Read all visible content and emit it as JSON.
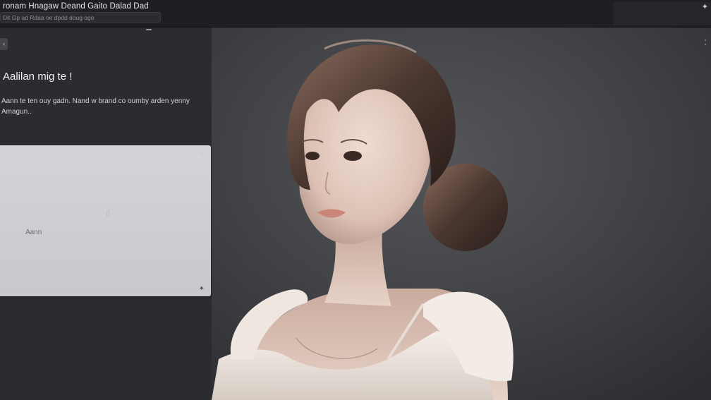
{
  "topbar": {
    "title": "ronam Hnagaw Deand Gaito Dalad Dad",
    "address": "Dit Gp ad Rdaa oe dpdd doug ogo",
    "sparkle_icon": "sparkle-icon"
  },
  "sidepanel": {
    "back_icon": "back-icon",
    "heading": "Aalilan mig te !",
    "description": "Aann te ten ouy gadn. Nand w brand co oumby arden yenny Amagun..",
    "card": {
      "label": "Aann",
      "mid_icon": "image-placeholder-icon",
      "corner_icon": "close-icon",
      "sparkle_icon": "sparkle-icon"
    }
  },
  "viewer": {
    "more_icon": "more-vertical-icon",
    "subject": "portrait-photo"
  },
  "colors": {
    "topbar": "#1e1f22",
    "panel": "#2b2c30",
    "card": "#d0d0d5",
    "background": "#3a3b3f"
  }
}
